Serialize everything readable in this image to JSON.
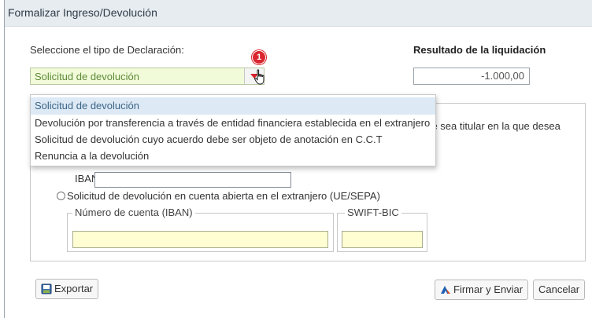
{
  "window": {
    "title": "Formalizar Ingreso/Devolución"
  },
  "form": {
    "tipo_label": "Seleccione el tipo de Declaración:",
    "tipo_selected": "Solicitud de devolución",
    "step_badge": "1",
    "result_label": "Resultado de la liquidación",
    "result_value": "-1.000,00"
  },
  "dropdown": {
    "options": [
      "Solicitud de devolución",
      "Devolución por transferencia a través de entidad financiera establecida en el extranjero",
      "Solicitud de devolución cuyo acuerdo debe ser objeto de anotación en C.C.T",
      "Renuncia a la devolución"
    ],
    "selected_index": 0
  },
  "devolucion": {
    "partial_text": "que sea titular en la que desea",
    "iban_label": "IBAN:",
    "iban_value": "",
    "foreign_radio_label": "Solicitud de devolución en cuenta abierta en el extranjero (UE/SEPA)",
    "account_legend": "Número de cuenta (IBAN)",
    "swift_legend": "SWIFT-BIC",
    "account_value": "",
    "swift_value": ""
  },
  "footer": {
    "export_label": "Exportar",
    "sign_label": "Firmar y Enviar",
    "cancel_label": "Cancelar"
  },
  "icons": {
    "dropdown_arrow": "caret-down-icon",
    "cursor": "hand-pointer-icon",
    "export": "document-export-icon",
    "sign": "signature-icon"
  },
  "colors": {
    "select_bg": "#f1fbd9",
    "select_text": "#5f8a3a",
    "badge": "#d9262e",
    "selected_option_bg": "#dde9f5",
    "input_yellow": "#fffdd2"
  }
}
